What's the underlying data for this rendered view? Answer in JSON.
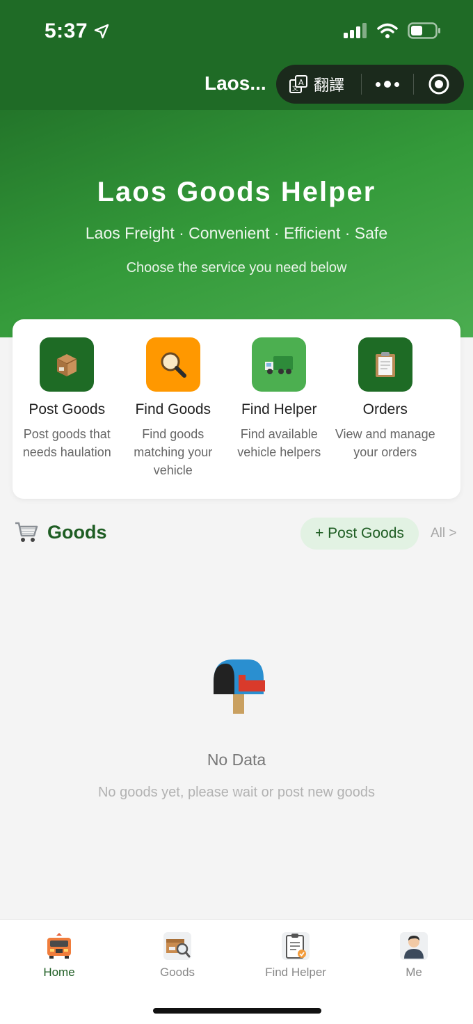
{
  "status_bar": {
    "time": "5:37"
  },
  "nav": {
    "title": "Laos...",
    "translate_label": "翻譯"
  },
  "hero": {
    "title": "Laos Goods Helper",
    "subtitle": "Laos Freight · Convenient · Efficient · Safe",
    "hint": "Choose the service you need below"
  },
  "services": [
    {
      "label": "Post Goods",
      "desc": "Post goods that needs haulation",
      "icon": "package-icon",
      "color": "#1e6b25"
    },
    {
      "label": "Find Goods",
      "desc": "Find goods matching your vehicle",
      "icon": "magnifier-icon",
      "color": "#ff9800"
    },
    {
      "label": "Find Helper",
      "desc": "Find available vehicle helpers",
      "icon": "truck-icon",
      "color": "#4caf50"
    },
    {
      "label": "Orders",
      "desc": "View and manage your orders",
      "icon": "clipboard-icon",
      "color": "#1e6b25"
    }
  ],
  "goods": {
    "title": "Goods",
    "post_button": "+ Post Goods",
    "all_link": "All >",
    "empty_title": "No Data",
    "empty_desc": "No goods yet, please wait or post new goods"
  },
  "tabs": [
    {
      "label": "Home",
      "icon": "truck-front-icon",
      "active": true
    },
    {
      "label": "Goods",
      "icon": "goods-search-icon",
      "active": false
    },
    {
      "label": "Find Helper",
      "icon": "clipboard-icon",
      "active": false
    },
    {
      "label": "Me",
      "icon": "user-icon",
      "active": false
    }
  ],
  "colors": {
    "primary": "#1f6b26",
    "accent_orange": "#ff9800",
    "light_green": "#4caf50"
  }
}
